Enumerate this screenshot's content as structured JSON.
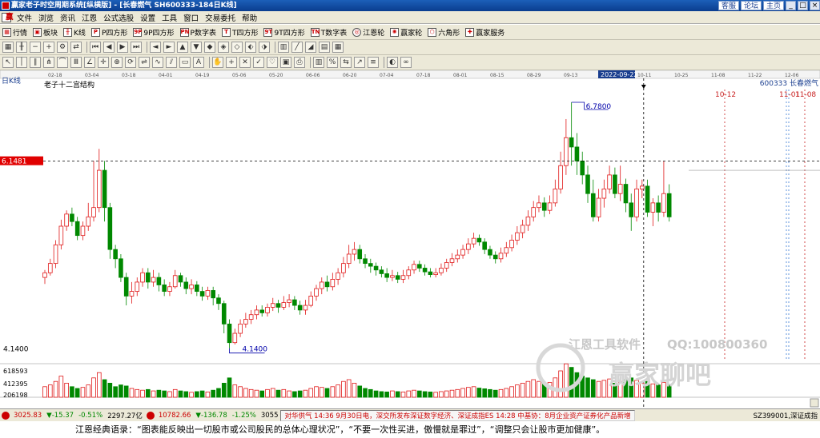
{
  "window": {
    "title": "赢家老子时空周期系统[纵横版] - [长春燃气  SH600333-184日K线]",
    "links": [
      "客服",
      "论坛",
      "主页"
    ]
  },
  "menu": [
    "文件",
    "浏览",
    "资讯",
    "江恩",
    "公式选股",
    "设置",
    "工具",
    "窗口",
    "交易委托",
    "帮助"
  ],
  "toolbar1": [
    {
      "icon": "grid",
      "label": "行情"
    },
    {
      "icon": "blocks",
      "label": "板块"
    },
    {
      "icon": "k",
      "label": "K线"
    },
    {
      "icon": "P",
      "label": "P四方形"
    },
    {
      "icon": "9P",
      "label": "9P四方形"
    },
    {
      "icon": "PN",
      "label": "P数字表"
    },
    {
      "icon": "T",
      "label": "T四方形"
    },
    {
      "icon": "9T",
      "label": "9T四方形"
    },
    {
      "icon": "TN",
      "label": "T数字表"
    },
    {
      "icon": "circle",
      "label": "江恩轮"
    },
    {
      "icon": "wheel",
      "label": "赢家轮"
    },
    {
      "icon": "hex",
      "label": "六角形"
    },
    {
      "icon": "service",
      "label": "赢家服务"
    }
  ],
  "chart": {
    "period_label": "日K线",
    "structure_label": "老子十二宫结构",
    "stock_label": "600333  长春燃气",
    "price_axis_label": "6.1481",
    "high_label": "6.7800",
    "low_label": "4.1400",
    "low_axis_label": "4.1400",
    "cursor_date": "2022-09-22",
    "forecast_dates": [
      "10-12",
      "11-01",
      "11-08"
    ],
    "timeline_dates": [
      "02-18",
      "03-04",
      "03-18",
      "04-01",
      "04-19",
      "05-06",
      "05-20",
      "06-06",
      "06-20",
      "07-04",
      "07-18",
      "08-01",
      "08-15",
      "08-29",
      "09-13",
      "2022-09-22",
      "10-11",
      "10-25",
      "11-08",
      "11-22",
      "12-06"
    ],
    "volume_labels": [
      "618593",
      "412395",
      "206198"
    ],
    "watermark_company": "江恩工具软件",
    "watermark_qq": "QQ:100800360",
    "watermark_brand": "赢家聊吧",
    "colors": {
      "up": "#e01818",
      "down": "#008800",
      "cursor": "#000000",
      "forecast": "#c81e1e",
      "forecast_blue": "#3a7bd5"
    }
  },
  "chart_data": {
    "type": "candlestick",
    "ylim": [
      4.0,
      6.9
    ],
    "highlight_price": 6.1481,
    "high": 6.78,
    "low": 4.14,
    "candles": [
      [
        4.9,
        4.95,
        4.83,
        4.98
      ],
      [
        4.95,
        5.05,
        4.92,
        5.1
      ],
      [
        5.05,
        5.25,
        5.0,
        5.3
      ],
      [
        5.25,
        5.45,
        5.2,
        5.52
      ],
      [
        5.45,
        5.58,
        5.4,
        5.62
      ],
      [
        5.58,
        5.5,
        5.45,
        5.65
      ],
      [
        5.5,
        5.35,
        5.3,
        5.55
      ],
      [
        5.35,
        5.45,
        5.3,
        5.5
      ],
      [
        5.45,
        5.55,
        5.4,
        5.7
      ],
      [
        5.55,
        5.65,
        5.5,
        6.15
      ],
      [
        5.65,
        6.05,
        5.6,
        6.28
      ],
      [
        6.05,
        5.65,
        5.5,
        6.15
      ],
      [
        5.65,
        5.2,
        5.1,
        5.7
      ],
      [
        5.2,
        5.1,
        5.0,
        5.25
      ],
      [
        5.1,
        4.9,
        4.85,
        5.15
      ],
      [
        4.9,
        4.7,
        4.6,
        4.95
      ],
      [
        4.7,
        4.75,
        4.62,
        4.85
      ],
      [
        4.75,
        4.85,
        4.7,
        4.9
      ],
      [
        4.85,
        4.95,
        4.8,
        5.0
      ],
      [
        4.95,
        4.85,
        4.78,
        5.0
      ],
      [
        4.85,
        4.9,
        4.8,
        4.98
      ],
      [
        4.9,
        4.82,
        4.75,
        4.95
      ],
      [
        4.82,
        4.75,
        4.7,
        4.88
      ],
      [
        4.75,
        4.8,
        4.7,
        4.85
      ],
      [
        4.8,
        4.92,
        4.78,
        4.98
      ],
      [
        4.92,
        4.85,
        4.8,
        4.95
      ],
      [
        4.85,
        4.78,
        4.72,
        4.9
      ],
      [
        4.78,
        4.82,
        4.72,
        4.88
      ],
      [
        4.82,
        4.75,
        4.7,
        4.86
      ],
      [
        4.75,
        4.7,
        4.65,
        4.8
      ],
      [
        4.7,
        4.76,
        4.66,
        4.8
      ],
      [
        4.76,
        4.68,
        4.6,
        4.8
      ],
      [
        4.68,
        4.62,
        4.55,
        4.72
      ],
      [
        4.62,
        4.4,
        4.3,
        4.65
      ],
      [
        4.4,
        4.2,
        4.14,
        4.45
      ],
      [
        4.2,
        4.3,
        4.18,
        4.35
      ],
      [
        4.3,
        4.4,
        4.26,
        4.45
      ],
      [
        4.4,
        4.45,
        4.36,
        4.52
      ],
      [
        4.45,
        4.5,
        4.4,
        4.55
      ],
      [
        4.5,
        4.55,
        4.45,
        4.6
      ],
      [
        4.55,
        4.52,
        4.48,
        4.6
      ],
      [
        4.52,
        4.58,
        4.48,
        4.62
      ],
      [
        4.58,
        4.62,
        4.54,
        4.68
      ],
      [
        4.62,
        4.58,
        4.52,
        4.66
      ],
      [
        4.58,
        4.63,
        4.55,
        4.7
      ],
      [
        4.63,
        4.66,
        4.58,
        4.72
      ],
      [
        4.66,
        4.6,
        4.55,
        4.7
      ],
      [
        4.6,
        4.55,
        4.5,
        4.65
      ],
      [
        4.55,
        4.6,
        4.5,
        4.66
      ],
      [
        4.6,
        4.7,
        4.58,
        4.75
      ],
      [
        4.7,
        4.78,
        4.65,
        4.82
      ],
      [
        4.78,
        4.85,
        4.72,
        4.9
      ],
      [
        4.85,
        4.8,
        4.75,
        4.92
      ],
      [
        4.8,
        4.88,
        4.76,
        4.95
      ],
      [
        4.88,
        4.95,
        4.82,
        5.0
      ],
      [
        4.95,
        5.05,
        4.9,
        5.12
      ],
      [
        5.05,
        5.15,
        5.0,
        5.25
      ],
      [
        5.15,
        5.2,
        5.08,
        5.28
      ],
      [
        5.2,
        5.1,
        5.05,
        5.25
      ],
      [
        5.1,
        5.05,
        5.0,
        5.15
      ],
      [
        5.05,
        5.02,
        4.95,
        5.1
      ],
      [
        5.02,
        4.98,
        4.92,
        5.06
      ],
      [
        4.98,
        4.94,
        4.9,
        5.02
      ],
      [
        4.94,
        4.9,
        4.85,
        5.0
      ],
      [
        4.9,
        4.92,
        4.86,
        4.98
      ],
      [
        4.92,
        4.88,
        4.84,
        4.96
      ],
      [
        4.88,
        4.92,
        4.84,
        4.98
      ],
      [
        4.92,
        4.98,
        4.88,
        5.02
      ],
      [
        4.98,
        5.04,
        4.94,
        5.08
      ],
      [
        5.04,
        5.0,
        4.96,
        5.08
      ],
      [
        5.0,
        4.96,
        4.92,
        5.04
      ],
      [
        4.96,
        4.93,
        4.9,
        5.0
      ],
      [
        4.93,
        4.95,
        4.9,
        5.0
      ],
      [
        4.95,
        5.0,
        4.92,
        5.05
      ],
      [
        5.0,
        5.06,
        4.96,
        5.1
      ],
      [
        5.06,
        5.1,
        5.02,
        5.16
      ],
      [
        5.1,
        5.14,
        5.06,
        5.2
      ],
      [
        5.14,
        5.2,
        5.1,
        5.25
      ],
      [
        5.2,
        5.26,
        5.15,
        5.32
      ],
      [
        5.26,
        5.32,
        5.22,
        5.38
      ],
      [
        5.32,
        5.28,
        5.24,
        5.36
      ],
      [
        5.28,
        5.2,
        5.15,
        5.32
      ],
      [
        5.2,
        5.14,
        5.1,
        5.24
      ],
      [
        5.14,
        5.1,
        5.05,
        5.18
      ],
      [
        5.1,
        5.16,
        5.06,
        5.22
      ],
      [
        5.16,
        5.22,
        5.12,
        5.28
      ],
      [
        5.22,
        5.3,
        5.18,
        5.36
      ],
      [
        5.3,
        5.38,
        5.25,
        5.45
      ],
      [
        5.38,
        5.46,
        5.32,
        5.52
      ],
      [
        5.46,
        5.55,
        5.4,
        5.62
      ],
      [
        5.55,
        5.65,
        5.5,
        5.72
      ],
      [
        5.65,
        5.7,
        5.6,
        5.78
      ],
      [
        5.7,
        5.62,
        5.55,
        5.76
      ],
      [
        5.62,
        5.7,
        5.58,
        5.78
      ],
      [
        5.7,
        5.85,
        5.66,
        5.95
      ],
      [
        5.85,
        6.1,
        5.8,
        6.25
      ],
      [
        6.1,
        6.4,
        6.0,
        6.6
      ],
      [
        6.4,
        6.3,
        6.1,
        6.78
      ],
      [
        6.3,
        6.15,
        6.0,
        6.45
      ],
      [
        6.15,
        6.0,
        5.9,
        6.25
      ],
      [
        6.0,
        5.8,
        5.7,
        6.1
      ],
      [
        5.8,
        5.55,
        5.5,
        5.95
      ],
      [
        5.55,
        5.75,
        5.5,
        5.85
      ],
      [
        5.75,
        5.85,
        5.65,
        5.95
      ],
      [
        5.85,
        6.0,
        5.8,
        6.1
      ],
      [
        6.0,
        5.8,
        5.75,
        6.08
      ],
      [
        5.8,
        5.9,
        5.72,
        6.1
      ],
      [
        5.9,
        5.7,
        5.6,
        5.96
      ],
      [
        5.7,
        5.55,
        5.4,
        5.8
      ],
      [
        5.55,
        5.85,
        5.5,
        5.95
      ],
      [
        5.85,
        5.88,
        5.75,
        5.95
      ],
      [
        5.88,
        5.6,
        5.55,
        5.95
      ],
      [
        5.6,
        5.7,
        5.45,
        5.75
      ],
      [
        5.7,
        5.6,
        5.5,
        5.78
      ],
      [
        5.6,
        5.8,
        5.55,
        6.15
      ],
      [
        5.8,
        5.55,
        5.5,
        5.9
      ]
    ],
    "volumes_rel": [
      0.3,
      0.35,
      0.45,
      0.6,
      0.4,
      0.3,
      0.25,
      0.28,
      0.35,
      0.55,
      0.7,
      0.5,
      0.4,
      0.3,
      0.35,
      0.32,
      0.25,
      0.22,
      0.2,
      0.22,
      0.18,
      0.2,
      0.18,
      0.16,
      0.22,
      0.18,
      0.16,
      0.14,
      0.16,
      0.18,
      0.15,
      0.2,
      0.25,
      0.4,
      0.55,
      0.35,
      0.3,
      0.25,
      0.22,
      0.2,
      0.18,
      0.22,
      0.25,
      0.2,
      0.22,
      0.18,
      0.16,
      0.18,
      0.2,
      0.25,
      0.3,
      0.28,
      0.25,
      0.3,
      0.35,
      0.45,
      0.5,
      0.4,
      0.32,
      0.25,
      0.22,
      0.18,
      0.16,
      0.15,
      0.18,
      0.16,
      0.15,
      0.18,
      0.2,
      0.18,
      0.16,
      0.15,
      0.14,
      0.16,
      0.18,
      0.2,
      0.22,
      0.25,
      0.28,
      0.3,
      0.26,
      0.24,
      0.22,
      0.2,
      0.22,
      0.25,
      0.3,
      0.35,
      0.4,
      0.45,
      0.5,
      0.45,
      0.4,
      0.42,
      0.55,
      0.75,
      0.95,
      0.85,
      0.7,
      0.6,
      0.55,
      0.5,
      0.45,
      0.48,
      0.52,
      0.4,
      0.45,
      0.5,
      0.55,
      0.48,
      0.4,
      0.45,
      0.38,
      0.35,
      0.42,
      0.36
    ]
  },
  "status": {
    "sh_index": "3025.83",
    "sh_change": "▼-15.37",
    "sh_pct": "-0.51%",
    "sh_amount": "2297.27亿",
    "sz_index": "10782.66",
    "sz_change": "▼-136.78",
    "sz_pct": "-1.25%",
    "sz_amount": "3055",
    "news": "对华供气  14:36  9月30日电，深交所发布深证数字经济、深证成指ES  14:28  中基协：8月企业资产证券化产品新增",
    "stock_code": "SZ399001,深证成指"
  },
  "quote_bar": "江恩经典语录：“图表能反映出一切股市或公司股民的总体心理状况”，“不要一次性买进，傲慢就是罪过”，“调整只会让股市更加健康”。"
}
